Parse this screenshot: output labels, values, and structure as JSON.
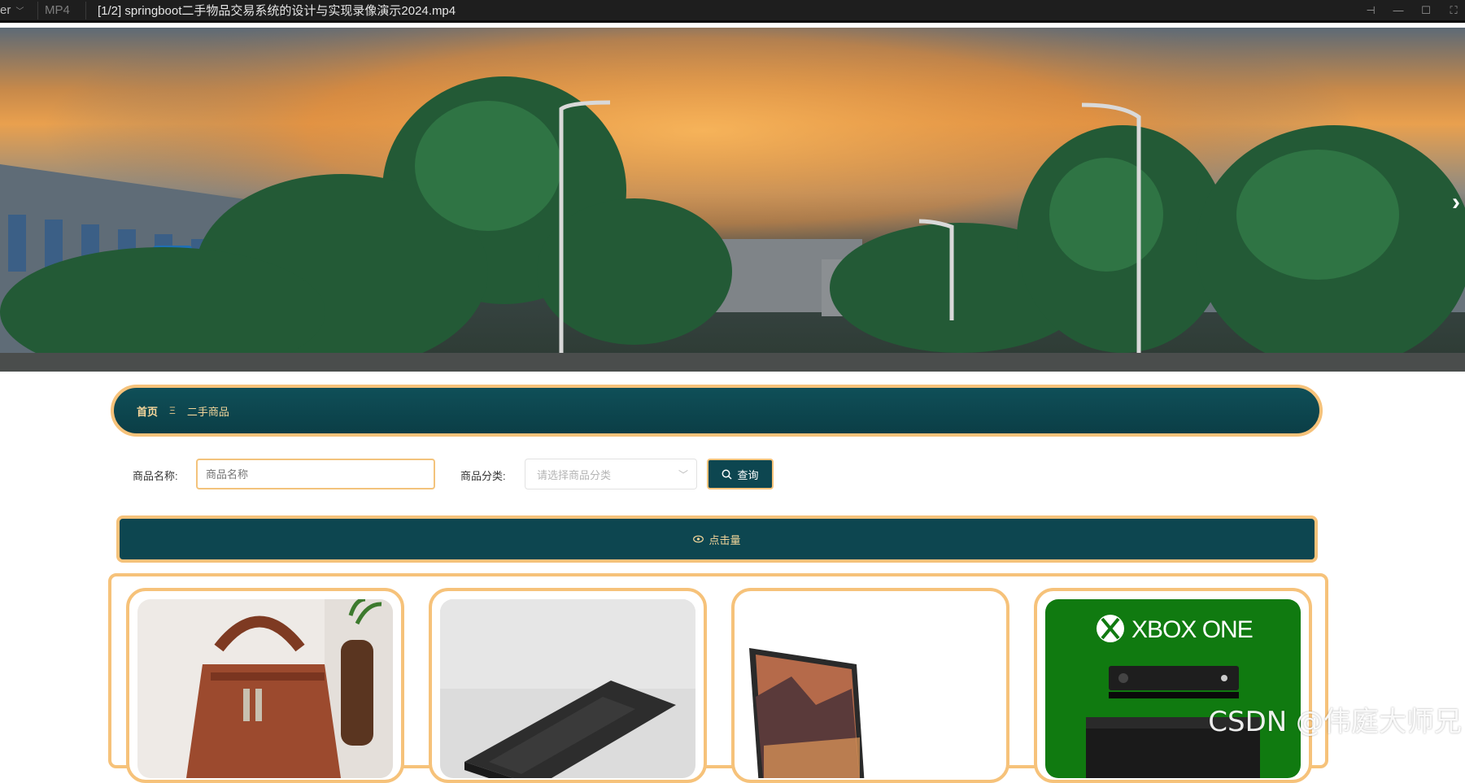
{
  "player": {
    "app_fragment": "er",
    "format": "MP4",
    "file_title": "[1/2] springboot二手物品交易系统的设计与实现录像演示2024.mp4"
  },
  "breadcrumb": {
    "home": "首页",
    "separator": "Ξ",
    "current": "二手商品"
  },
  "search": {
    "name_label": "商品名称:",
    "name_placeholder": "商品名称",
    "category_label": "商品分类:",
    "category_placeholder": "请选择商品分类",
    "query_button": "查询"
  },
  "sort": {
    "label": "点击量"
  },
  "products": [
    {
      "image": "brown leather handbag"
    },
    {
      "image": "black laptop closed"
    },
    {
      "image": "laptop with mountain screen"
    },
    {
      "image": "xbox one console box",
      "brand_text": "XBOX ONE"
    }
  ],
  "watermark": "CSDN @伟庭大师兄",
  "colors": {
    "teal": "#0d4650",
    "accent_gold": "#f6c27a",
    "crumb_text": "#f2d59a"
  }
}
